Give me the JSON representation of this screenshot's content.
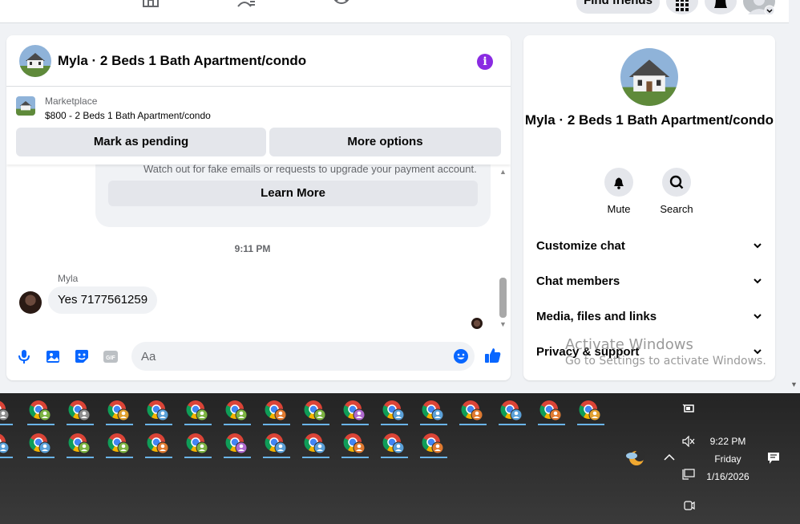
{
  "nav": {
    "find_friends_label": "Find friends"
  },
  "chat": {
    "title": "Myla · 2 Beds 1 Bath Apartment/condo",
    "marketplace_label": "Marketplace",
    "listing": "$800 - 2 Beds 1 Bath Apartment/condo",
    "mark_pending_label": "Mark as pending",
    "more_options_label": "More options",
    "warning_text": "Watch out for fake emails or requests to upgrade your payment account.",
    "learn_more_label": "Learn More",
    "timestamp": "9:11 PM",
    "sender": "Myla",
    "message": "Yes 7177561259",
    "input_placeholder": "Aa"
  },
  "info_panel": {
    "name": "Myla · 2 Beds 1 Bath Apartment/condo",
    "mute_label": "Mute",
    "search_label": "Search",
    "sections": [
      "Customize chat",
      "Chat members",
      "Media, files and links",
      "Privacy & support"
    ]
  },
  "watermark": {
    "line1": "Activate Windows",
    "line2": "Go to Settings to activate Windows."
  },
  "taskbar": {
    "time": "9:22 PM",
    "day": "Friday",
    "date": "1/16/2026"
  },
  "colors": {
    "accent": "#0866ff",
    "info_purple": "#8a2be2",
    "chrome_red": "#db4437",
    "chrome_green": "#0f9d58",
    "chrome_yellow": "#f4b400"
  },
  "icons": [
    "home-icon",
    "friends-icon",
    "groups-icon",
    "apps-grid-icon",
    "bell-icon",
    "profile-icon",
    "info-icon",
    "mic-icon",
    "image-icon",
    "sticker-icon",
    "gif-icon",
    "emoji-icon",
    "thumbs-up-icon",
    "chevron-down-icon",
    "chrome-icon",
    "weather-icon",
    "volume-mute-icon",
    "network-icon",
    "notification-icon"
  ]
}
